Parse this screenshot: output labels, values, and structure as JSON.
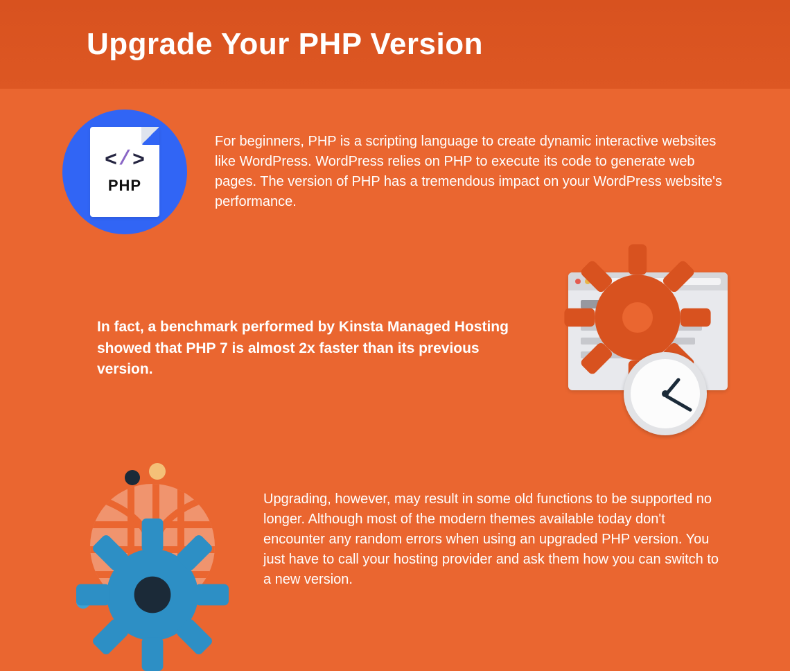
{
  "header": {
    "title": "Upgrade Your PHP Version"
  },
  "sections": {
    "intro": {
      "text": "For beginners, PHP is a scripting language to create dynamic interactive websites like WordPress. WordPress relies on PHP to execute its code to generate web pages. The version of PHP has a tremendous impact on your WordPress website's performance.",
      "icon_label": "PHP"
    },
    "benchmark": {
      "text": "In fact, a benchmark performed by Kinsta Managed Hosting showed that PHP 7 is almost 2x faster than its previous version."
    },
    "upgrade": {
      "text": "Upgrading, however, may result in some old functions to be supported no longer. Although most of the modern themes available today don't encounter any random errors when using an upgraded PHP version. You just have to call your hosting provider and ask them how you can switch to a new version."
    }
  },
  "colors": {
    "bg": "#ea6630",
    "header_bg": "#d8521f",
    "accent_blue": "#3165f5",
    "gear_blue": "#2d8fc5",
    "text": "#ffffff"
  }
}
